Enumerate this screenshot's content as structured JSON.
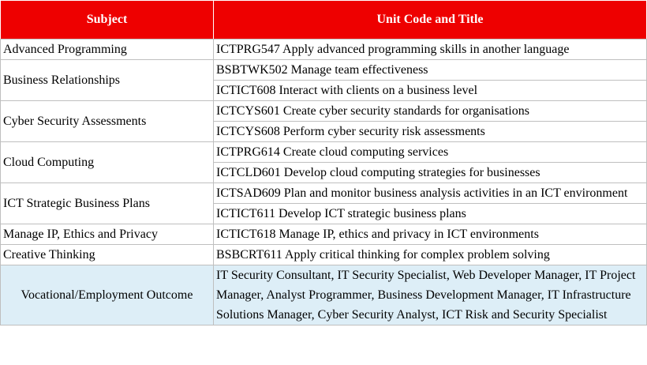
{
  "header": {
    "subject": "Subject",
    "unit": "Unit Code and Title"
  },
  "rows": [
    {
      "subject": "Advanced Programming",
      "units": [
        "ICTPRG547 Apply advanced programming skills in another language"
      ]
    },
    {
      "subject": "Business Relationships",
      "units": [
        "BSBTWK502 Manage team effectiveness",
        "ICTICT608 Interact with clients on a business level"
      ]
    },
    {
      "subject": "Cyber Security Assessments",
      "units": [
        "ICTCYS601 Create cyber security standards for organisations",
        "ICTCYS608 Perform cyber security risk assessments"
      ]
    },
    {
      "subject": "Cloud Computing",
      "units": [
        "ICTPRG614 Create cloud computing services",
        "ICTCLD601 Develop cloud computing strategies for businesses"
      ]
    },
    {
      "subject": "ICT Strategic Business Plans",
      "units": [
        "ICTSAD609 Plan and monitor business analysis activities in an ICT environment",
        "ICTICT611 Develop ICT strategic business plans"
      ]
    },
    {
      "subject": "Manage IP, Ethics and Privacy",
      "units": [
        "ICTICT618 Manage IP, ethics and privacy in ICT environments"
      ]
    },
    {
      "subject": "Creative Thinking",
      "units": [
        "BSBCRT611 Apply critical thinking for complex problem solving"
      ]
    }
  ],
  "outcome": {
    "subject": "Vocational/Employment Outcome",
    "text": "IT Security Consultant, IT Security Specialist, Web Developer Manager, IT Project Manager, Analyst Programmer, Business Development Manager, IT Infrastructure Solutions Manager, Cyber Security Analyst, ICT Risk and Security Specialist"
  },
  "colors": {
    "header_bg": "#ee0000",
    "header_text": "#ffffff",
    "outcome_bg": "#ddeef7",
    "border": "#bfbfbf"
  }
}
